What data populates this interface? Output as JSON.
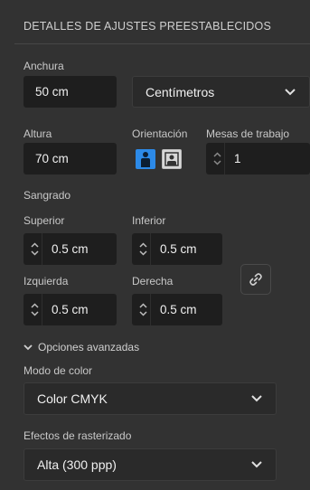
{
  "panel": {
    "title": "DETALLES DE AJUSTES PREESTABLECIDOS"
  },
  "width": {
    "label": "Anchura",
    "value": "50 cm",
    "unit": "Centímetros"
  },
  "height": {
    "label": "Altura",
    "value": "70 cm"
  },
  "orientation": {
    "label": "Orientación",
    "selected": "portrait"
  },
  "artboards": {
    "label": "Mesas de trabajo",
    "value": "1"
  },
  "bleed": {
    "label": "Sangrado",
    "top": {
      "label": "Superior",
      "value": "0.5 cm"
    },
    "bottom": {
      "label": "Inferior",
      "value": "0.5 cm"
    },
    "left": {
      "label": "Izquierda",
      "value": "0.5 cm"
    },
    "right": {
      "label": "Derecha",
      "value": "0.5 cm"
    }
  },
  "advanced": {
    "toggle_label": "Opciones avanzadas",
    "color_mode": {
      "label": "Modo de color",
      "value": "Color CMYK"
    },
    "raster": {
      "label": "Efectos de rasterizado",
      "value": "Alta (300 ppp)"
    }
  },
  "colors": {
    "background": "#323232",
    "field": "#1e1e1e",
    "accent": "#2c8ae8"
  },
  "icons": [
    "chevron-down-icon",
    "portrait-icon",
    "landscape-icon",
    "link-icon",
    "stepper-arrows-icon"
  ]
}
